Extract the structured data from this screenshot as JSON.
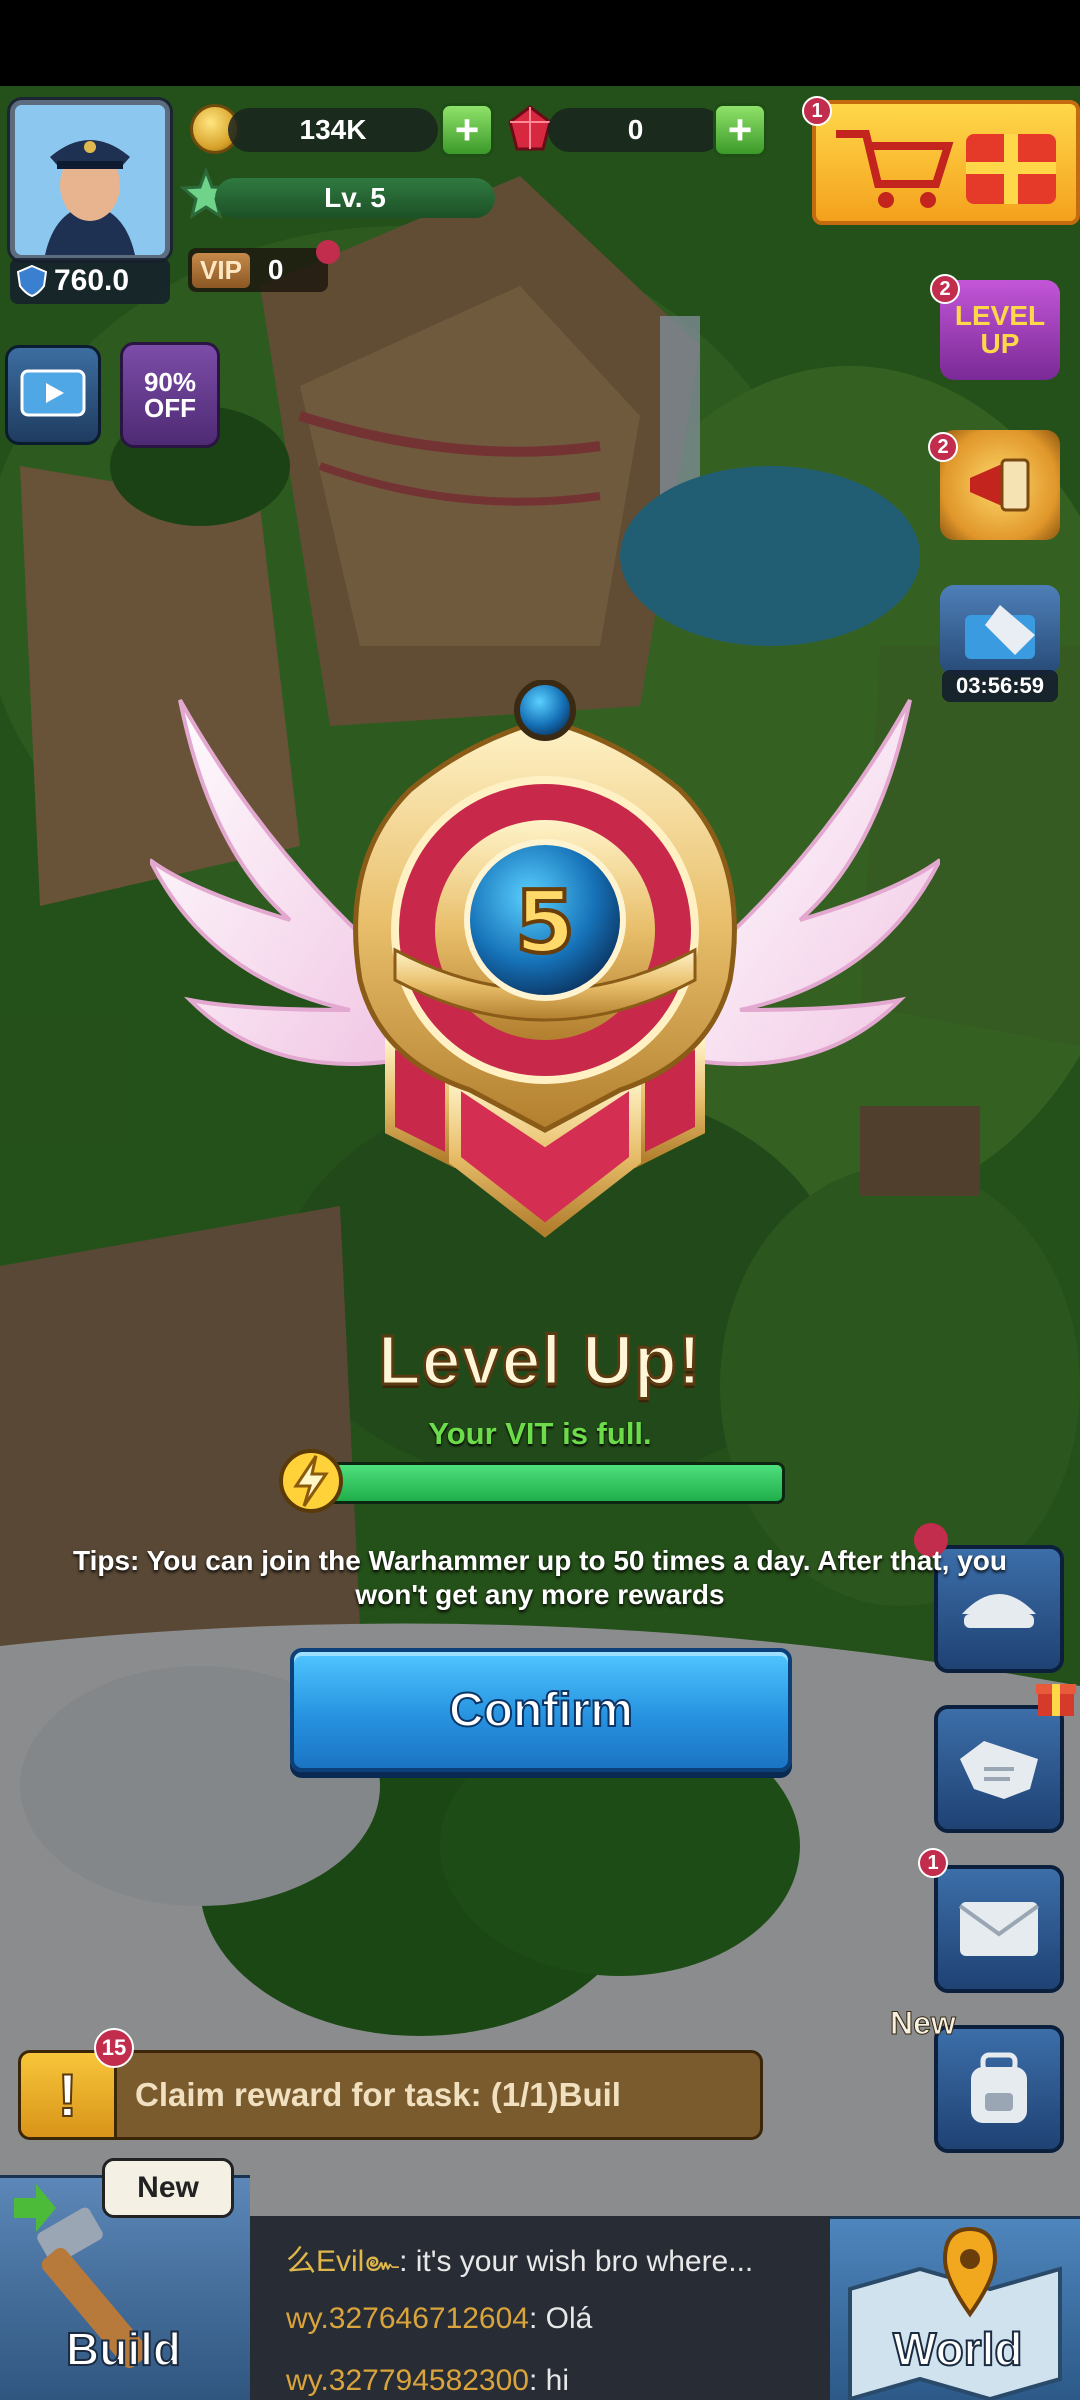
{
  "hud": {
    "power": "760.0",
    "coins": "134K",
    "gems": "0",
    "level": "Lv. 5",
    "vip_label": "VIP",
    "vip_level": "0",
    "shop_badge": "1",
    "levelup_badge": "2",
    "levelup_icon_text": "LEVEL UP",
    "events_badge": "2",
    "discount_text": "90% OFF",
    "timer": "03:56:59"
  },
  "modal": {
    "emblem_level": "5",
    "title": "Level Up!",
    "vit_message": "Your VIT is full.",
    "vit_fill_fraction": 1.0,
    "tips": "Tips: You can join the Warhammer up to 50 times a day. After that, you won't get any more rewards",
    "confirm_label": "Confirm"
  },
  "side_menu": {
    "mail_badge": "1",
    "new_label": "New"
  },
  "task": {
    "badge": "15",
    "text": "Claim reward for task: (1/1)Buil"
  },
  "bottom": {
    "build_label": "Build",
    "build_new_tag": "New",
    "world_label": "World",
    "chat": [
      {
        "name": "么Evil๛",
        "message": ": it's your wish bro where..."
      },
      {
        "name": "wy.327646712604",
        "message": ": Olá"
      },
      {
        "name": "wy.327794582300",
        "message": ": hi"
      }
    ]
  },
  "colors": {
    "confirm_button": "#2793e0",
    "vit_bar": "#1fae4a",
    "vit_text": "#6cdc4a",
    "badge": "#c22d4d"
  }
}
